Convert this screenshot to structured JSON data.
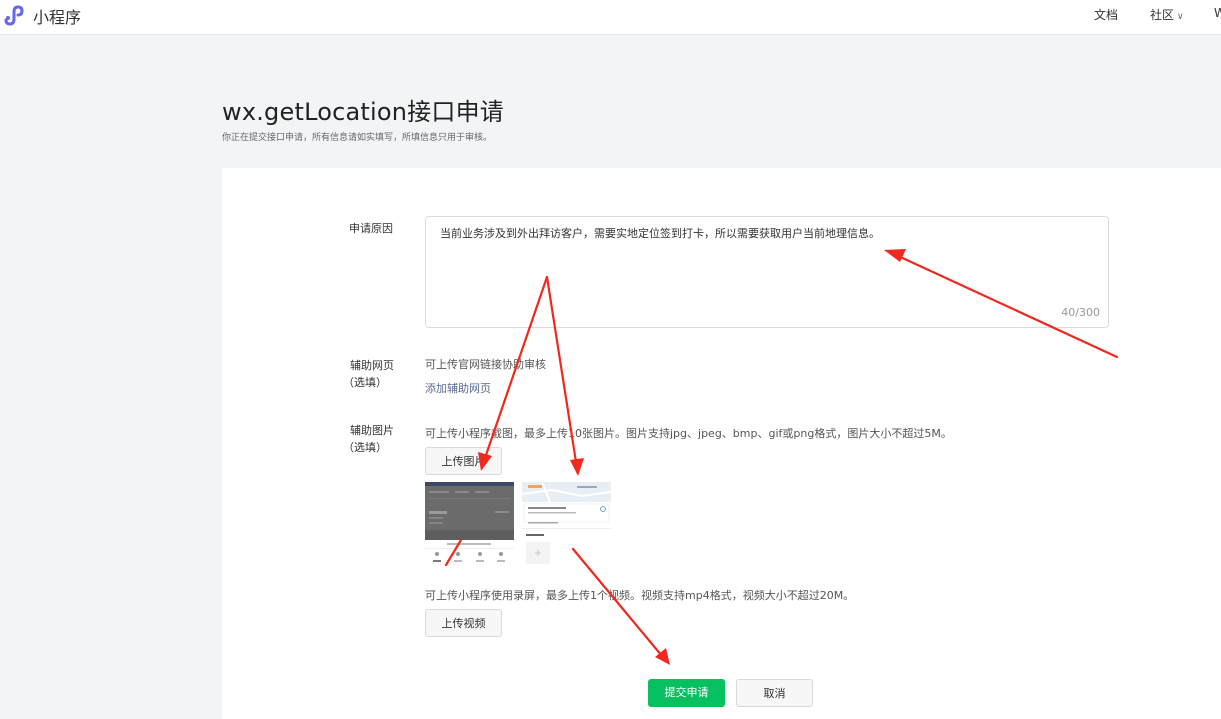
{
  "header": {
    "brand": "小程序",
    "nav": {
      "docs": "文档",
      "community": "社区",
      "cut": "W"
    }
  },
  "page": {
    "title": "wx.getLocation接口申请",
    "subtitle": "你正在提交接口申请，所有信息请如实填写，所填信息只用于审核。"
  },
  "form": {
    "reason": {
      "label": "申请原因",
      "value": "当前业务涉及到外出拜访客户，需要实地定位签到打卡，所以需要获取用户当前地理信息。",
      "count": "40/300"
    },
    "webpage": {
      "label": "辅助网页",
      "optional": "（选填）",
      "hint": "可上传官网链接协助审核",
      "add_link": "添加辅助网页"
    },
    "images": {
      "label": "辅助图片",
      "optional": "（选填）",
      "hint": "可上传小程序截图，最多上传10张图片。图片支持jpg、jpeg、bmp、gif或png格式，图片大小不超过5M。",
      "upload_button": "上传图片"
    },
    "video": {
      "hint": "可上传小程序使用录屏，最多上传1个视频。视频支持mp4格式，视频大小不超过20M。",
      "upload_button": "上传视频"
    },
    "actions": {
      "submit": "提交申请",
      "cancel": "取消"
    }
  },
  "colors": {
    "primary": "#07c160",
    "arrow": "#f0281e",
    "link": "#576b95",
    "logo": "#6467f0"
  },
  "icons": {
    "logo": "mini-program-logo-icon",
    "chevron": "chevron-down-icon",
    "plus": "plus-icon"
  }
}
